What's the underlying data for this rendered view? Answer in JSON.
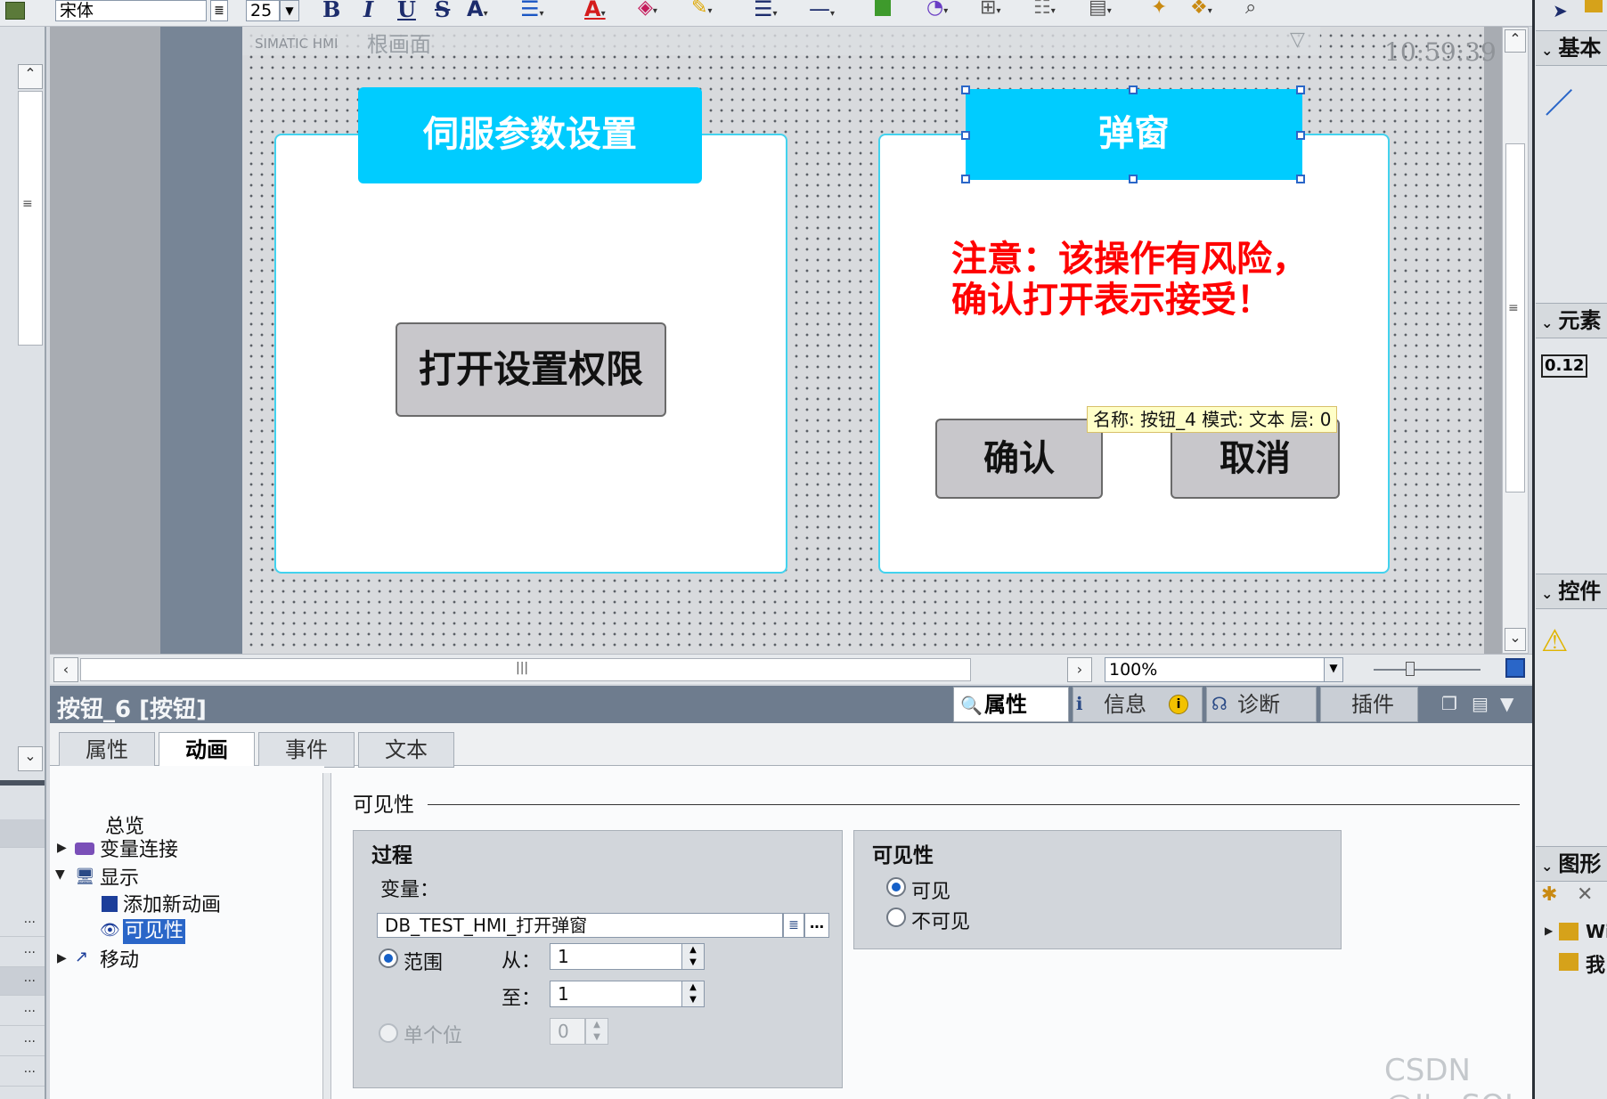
{
  "toolbar": {
    "font_name": "宋体",
    "font_size": "25",
    "bold": "B",
    "italic": "I",
    "underline": "U",
    "strike": "S"
  },
  "screen": {
    "header_left": "SIMATIC HMI",
    "header_mid": "根画面",
    "clock": "10:59:39",
    "zoom": "100%"
  },
  "panel_left": {
    "title": "伺服参数设置",
    "button": "打开设置权限"
  },
  "panel_right": {
    "title": "弹窗",
    "warning_line1": "注意：该操作有风险，",
    "warning_line2": "确认打开表示接受！",
    "confirm": "确认",
    "cancel": "取消",
    "tooltip": "名称: 按钮_4   模式: 文本   层: 0"
  },
  "inspector": {
    "title": "按钮_6 [按钮]",
    "right_tabs": [
      "属性",
      "信息",
      "诊断",
      "插件"
    ],
    "tabs": [
      "属性",
      "动画",
      "事件",
      "文本"
    ],
    "tree": [
      "总览",
      "变量连接",
      "显示",
      "添加新动画",
      "可见性",
      "移动"
    ],
    "section_title": "可见性",
    "process_title": "过程",
    "variable_label": "变量：",
    "variable_value": "DB_TEST_HMI_打开弹窗",
    "range_label": "范围",
    "from_label": "从：",
    "from_value": "1",
    "to_label": "至：",
    "to_value": "1",
    "single_bit_label": "单个位",
    "single_bit_value": "0",
    "visibility_title": "可见性",
    "visible": "可见",
    "invisible": "不可见"
  },
  "right_panel": {
    "basic": "基本",
    "elements": "元素",
    "controls": "控件",
    "graphics": "图形",
    "io_text": "0.12",
    "item_w": "Wi",
    "item_my": "我"
  },
  "left_strip": {
    "dots": "..."
  },
  "watermark": "CSDN @I'mSQL",
  "colors": {
    "title_bg": "#00ccff",
    "panel_border": "#42d2ee",
    "warning": "#ff0000",
    "props_header": "#6e7c8e"
  }
}
